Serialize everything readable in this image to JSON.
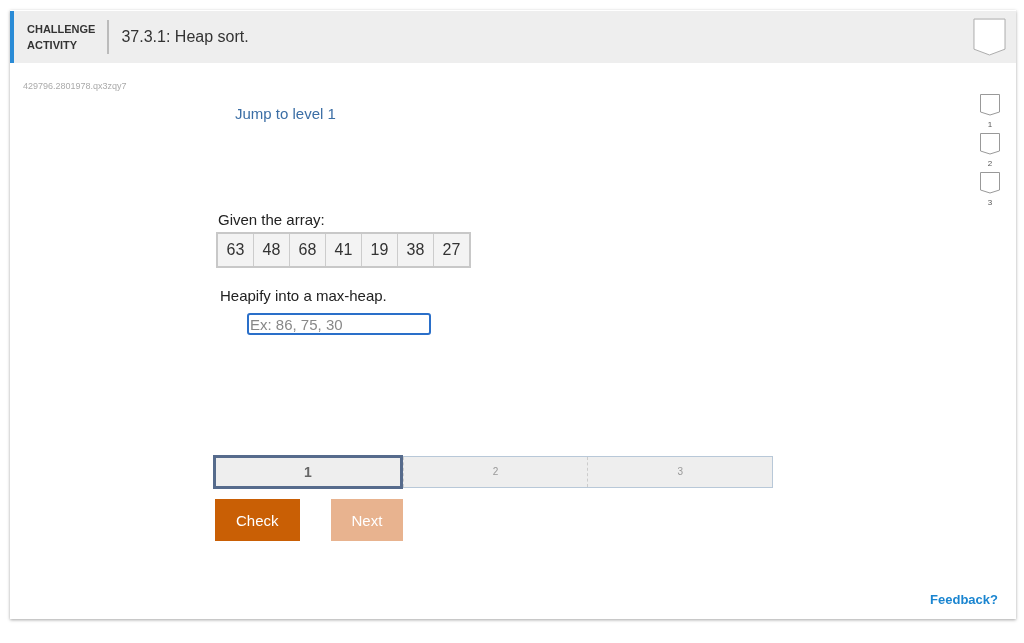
{
  "header": {
    "label_lines": [
      "CHALLENGE",
      "ACTIVITY"
    ],
    "title": "37.3.1: Heap sort."
  },
  "activity_id": "429796.2801978.qx3zqy7",
  "jump_link": "Jump to level 1",
  "side_levels": [
    {
      "label": "1"
    },
    {
      "label": "2"
    },
    {
      "label": "3"
    }
  ],
  "prompt": "Given the array:",
  "array": [
    "63",
    "48",
    "68",
    "41",
    "19",
    "38",
    "27"
  ],
  "instruction": "Heapify into a max-heap.",
  "answer": {
    "placeholder": "Ex: 86, 75, 30"
  },
  "levels": [
    {
      "label": "1",
      "selected": true
    },
    {
      "label": "2",
      "selected": false
    },
    {
      "label": "3",
      "selected": false
    }
  ],
  "buttons": [
    {
      "label": "Check",
      "disabled": false
    },
    {
      "label": "Next",
      "disabled": true
    }
  ],
  "feedback": "Feedback?"
}
